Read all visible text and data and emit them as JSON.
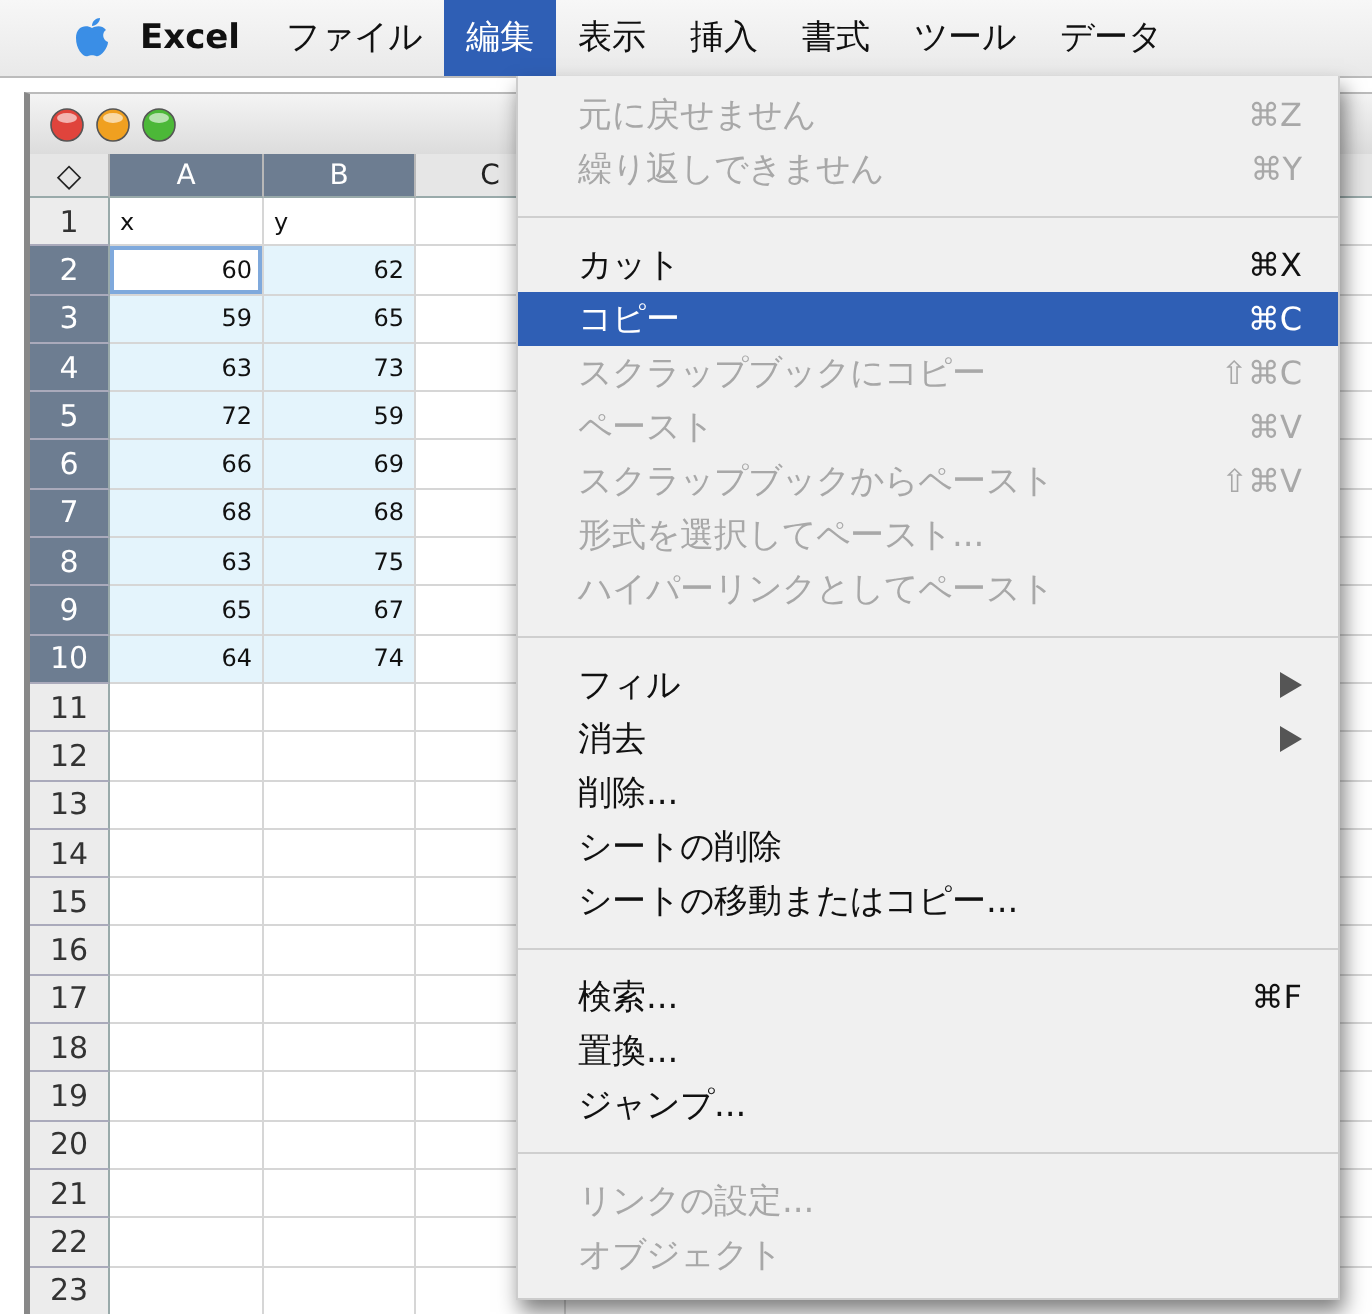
{
  "menu_bar": {
    "app_name": "Excel",
    "items": [
      {
        "label": "ファイル",
        "selected": false
      },
      {
        "label": "編集",
        "selected": true
      },
      {
        "label": "表示",
        "selected": false
      },
      {
        "label": "挿入",
        "selected": false
      },
      {
        "label": "書式",
        "selected": false
      },
      {
        "label": "ツール",
        "selected": false
      },
      {
        "label": "データ",
        "selected": false
      }
    ]
  },
  "spreadsheet": {
    "corner": "◇",
    "columns": [
      {
        "label": "A",
        "selected": true
      },
      {
        "label": "B",
        "selected": true
      },
      {
        "label": "C",
        "selected": false
      }
    ],
    "rows": [
      {
        "number": "1",
        "selected": false,
        "active": false,
        "cells": [
          "x",
          "y",
          ""
        ]
      },
      {
        "number": "2",
        "selected": true,
        "active": true,
        "cells": [
          "60",
          "62",
          ""
        ]
      },
      {
        "number": "3",
        "selected": true,
        "active": false,
        "cells": [
          "59",
          "65",
          ""
        ]
      },
      {
        "number": "4",
        "selected": true,
        "active": false,
        "cells": [
          "63",
          "73",
          ""
        ]
      },
      {
        "number": "5",
        "selected": true,
        "active": false,
        "cells": [
          "72",
          "59",
          ""
        ]
      },
      {
        "number": "6",
        "selected": true,
        "active": false,
        "cells": [
          "66",
          "69",
          ""
        ]
      },
      {
        "number": "7",
        "selected": true,
        "active": false,
        "cells": [
          "68",
          "68",
          ""
        ]
      },
      {
        "number": "8",
        "selected": true,
        "active": false,
        "cells": [
          "63",
          "75",
          ""
        ]
      },
      {
        "number": "9",
        "selected": true,
        "active": false,
        "cells": [
          "65",
          "67",
          ""
        ]
      },
      {
        "number": "10",
        "selected": true,
        "active": false,
        "cells": [
          "64",
          "74",
          ""
        ]
      },
      {
        "number": "11",
        "selected": false,
        "active": false,
        "cells": [
          "",
          "",
          ""
        ]
      },
      {
        "number": "12",
        "selected": false,
        "active": false,
        "cells": [
          "",
          "",
          ""
        ]
      },
      {
        "number": "13",
        "selected": false,
        "active": false,
        "cells": [
          "",
          "",
          ""
        ]
      },
      {
        "number": "14",
        "selected": false,
        "active": false,
        "cells": [
          "",
          "",
          ""
        ]
      },
      {
        "number": "15",
        "selected": false,
        "active": false,
        "cells": [
          "",
          "",
          ""
        ]
      },
      {
        "number": "16",
        "selected": false,
        "active": false,
        "cells": [
          "",
          "",
          ""
        ]
      },
      {
        "number": "17",
        "selected": false,
        "active": false,
        "cells": [
          "",
          "",
          ""
        ]
      },
      {
        "number": "18",
        "selected": false,
        "active": false,
        "cells": [
          "",
          "",
          ""
        ]
      },
      {
        "number": "19",
        "selected": false,
        "active": false,
        "cells": [
          "",
          "",
          ""
        ]
      },
      {
        "number": "20",
        "selected": false,
        "active": false,
        "cells": [
          "",
          "",
          ""
        ]
      },
      {
        "number": "21",
        "selected": false,
        "active": false,
        "cells": [
          "",
          "",
          ""
        ]
      },
      {
        "number": "22",
        "selected": false,
        "active": false,
        "cells": [
          "",
          "",
          ""
        ]
      },
      {
        "number": "23",
        "selected": false,
        "active": false,
        "cells": [
          "",
          "",
          ""
        ]
      }
    ]
  },
  "edit_menu": {
    "groups": [
      [
        {
          "label": "元に戻せません",
          "shortcut": "⌘Z",
          "disabled": true,
          "selected": false,
          "submenu": false
        },
        {
          "label": "繰り返しできません",
          "shortcut": "⌘Y",
          "disabled": true,
          "selected": false,
          "submenu": false
        }
      ],
      [
        {
          "label": "カット",
          "shortcut": "⌘X",
          "disabled": false,
          "selected": false,
          "submenu": false
        },
        {
          "label": "コピー",
          "shortcut": "⌘C",
          "disabled": false,
          "selected": true,
          "submenu": false
        },
        {
          "label": "スクラップブックにコピー",
          "shortcut": "⇧⌘C",
          "disabled": true,
          "selected": false,
          "submenu": false
        },
        {
          "label": "ペースト",
          "shortcut": "⌘V",
          "disabled": true,
          "selected": false,
          "submenu": false
        },
        {
          "label": "スクラップブックからペースト",
          "shortcut": "⇧⌘V",
          "disabled": true,
          "selected": false,
          "submenu": false
        },
        {
          "label": "形式を選択してペースト...",
          "disabled": true,
          "selected": false,
          "submenu": false
        },
        {
          "label": "ハイパーリンクとしてペースト",
          "disabled": true,
          "selected": false,
          "submenu": false
        }
      ],
      [
        {
          "label": "フィル",
          "disabled": false,
          "selected": false,
          "submenu": true
        },
        {
          "label": "消去",
          "disabled": false,
          "selected": false,
          "submenu": true
        },
        {
          "label": "削除...",
          "disabled": false,
          "selected": false,
          "submenu": false
        },
        {
          "label": "シートの削除",
          "disabled": false,
          "selected": false,
          "submenu": false
        },
        {
          "label": "シートの移動またはコピー...",
          "disabled": false,
          "selected": false,
          "submenu": false
        }
      ],
      [
        {
          "label": "検索...",
          "shortcut": "⌘F",
          "disabled": false,
          "selected": false,
          "submenu": false
        },
        {
          "label": "置換...",
          "disabled": false,
          "selected": false,
          "submenu": false
        },
        {
          "label": "ジャンプ...",
          "disabled": false,
          "selected": false,
          "submenu": false
        }
      ],
      [
        {
          "label": "リンクの設定...",
          "disabled": true,
          "selected": false,
          "submenu": false
        },
        {
          "label": "オブジェクト",
          "disabled": true,
          "selected": false,
          "submenu": false
        }
      ]
    ]
  }
}
